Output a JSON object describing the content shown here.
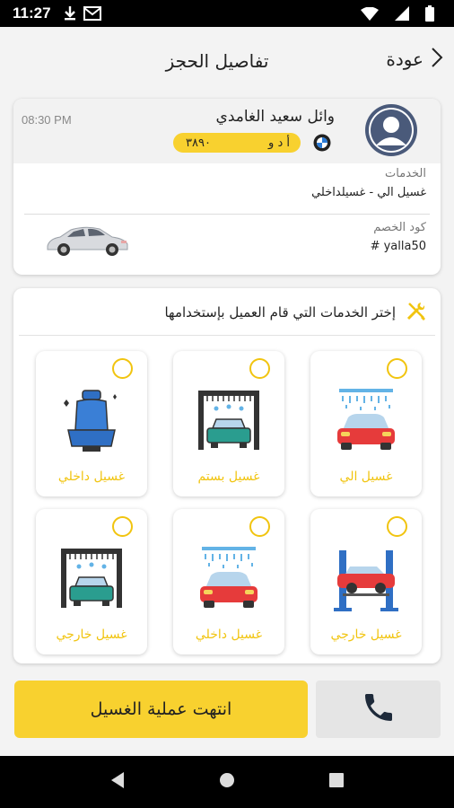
{
  "status_bar": {
    "time": "11:27"
  },
  "header": {
    "title": "تفاصيل الحجز",
    "back_label": "عودة"
  },
  "booking": {
    "customer_name": "وائل سعيد الغامدي",
    "time": "08:30 PM",
    "plate_letters": "أ د و",
    "plate_numbers": "٣٨٩٠",
    "services_label": "الخدمات",
    "services_value": "غسيل الي - غسيلداخلي",
    "discount_label": "كود الخصم",
    "discount_value": "# yalla50"
  },
  "services_section": {
    "title": "إختر الخدمات التي قام العميل بإستخدامها",
    "tiles": [
      {
        "label": "غسيل الي",
        "icon": "car-wash-shower-icon",
        "selected": false
      },
      {
        "label": "غسيل بستم",
        "icon": "car-wash-steam-icon",
        "selected": false
      },
      {
        "label": "غسيل داخلي",
        "icon": "car-seat-icon",
        "selected": false
      },
      {
        "label": "غسيل خارجي",
        "icon": "car-lift-icon",
        "selected": false
      },
      {
        "label": "غسيل داخلي",
        "icon": "car-wash-shower-icon",
        "selected": false
      },
      {
        "label": "غسيل خارجي",
        "icon": "car-wash-tunnel-icon",
        "selected": false
      }
    ]
  },
  "actions": {
    "finish_label": "انتهت عملية الغسيل"
  },
  "colors": {
    "accent": "#f8d12f",
    "radio": "#f1c40f",
    "background": "#f3f3f3"
  }
}
